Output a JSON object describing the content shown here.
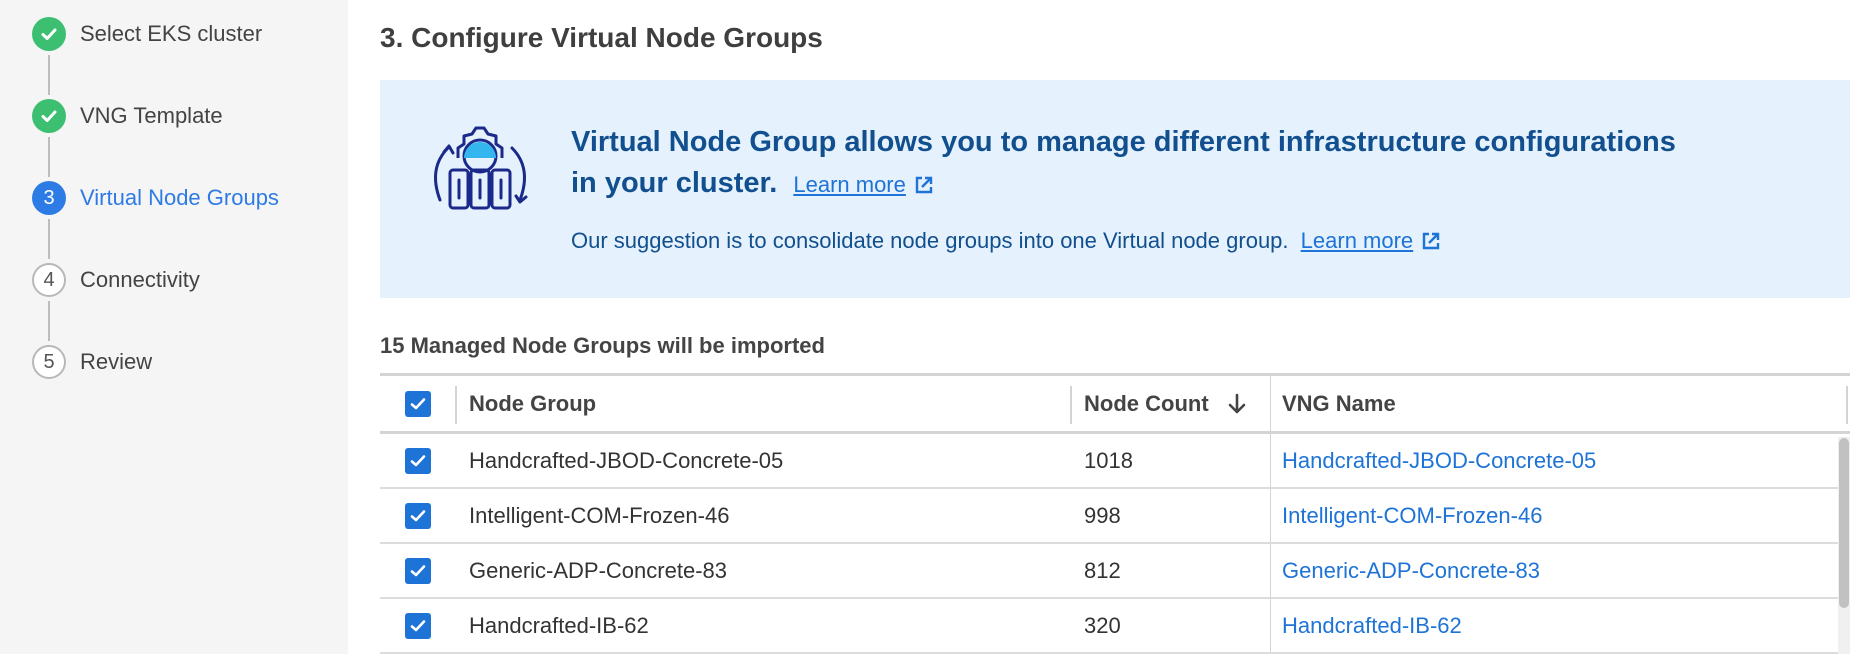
{
  "steps": [
    {
      "number": "1",
      "label": "Select EKS cluster",
      "state": "done"
    },
    {
      "number": "2",
      "label": "VNG Template",
      "state": "done"
    },
    {
      "number": "3",
      "label": "Virtual Node Groups",
      "state": "active"
    },
    {
      "number": "4",
      "label": "Connectivity",
      "state": "pending"
    },
    {
      "number": "5",
      "label": "Review",
      "state": "pending"
    }
  ],
  "page_title": "3. Configure Virtual Node Groups",
  "banner": {
    "title": "Virtual Node Group allows you to manage different infrastructure configurations in your cluster.",
    "title_link": "Learn more",
    "subtitle": "Our suggestion is to consolidate node groups into one Virtual node group.",
    "subtitle_link": "Learn more",
    "illustration_icon": "gear-nodes-icon",
    "link_icon": "external-link-icon"
  },
  "import_count_text": "15 Managed Node Groups will be imported",
  "table": {
    "header_checked": true,
    "columns": [
      "Node Group",
      "Node Count",
      "VNG Name"
    ],
    "sort_column": "Node Count",
    "sort_direction": "desc",
    "rows": [
      {
        "checked": true,
        "node_group": "Handcrafted-JBOD-Concrete-05",
        "node_count": "1018",
        "vng_name": "Handcrafted-JBOD-Concrete-05"
      },
      {
        "checked": true,
        "node_group": "Intelligent-COM-Frozen-46",
        "node_count": "998",
        "vng_name": "Intelligent-COM-Frozen-46"
      },
      {
        "checked": true,
        "node_group": "Generic-ADP-Concrete-83",
        "node_count": "812",
        "vng_name": "Generic-ADP-Concrete-83"
      },
      {
        "checked": true,
        "node_group": "Handcrafted-IB-62",
        "node_count": "320",
        "vng_name": "Handcrafted-IB-62"
      }
    ]
  },
  "colors": {
    "done": "#3dbf72",
    "active": "#2d7be5",
    "banner_bg": "#e5f1fc",
    "banner_text": "#114f8f",
    "link": "#1e73d6"
  }
}
